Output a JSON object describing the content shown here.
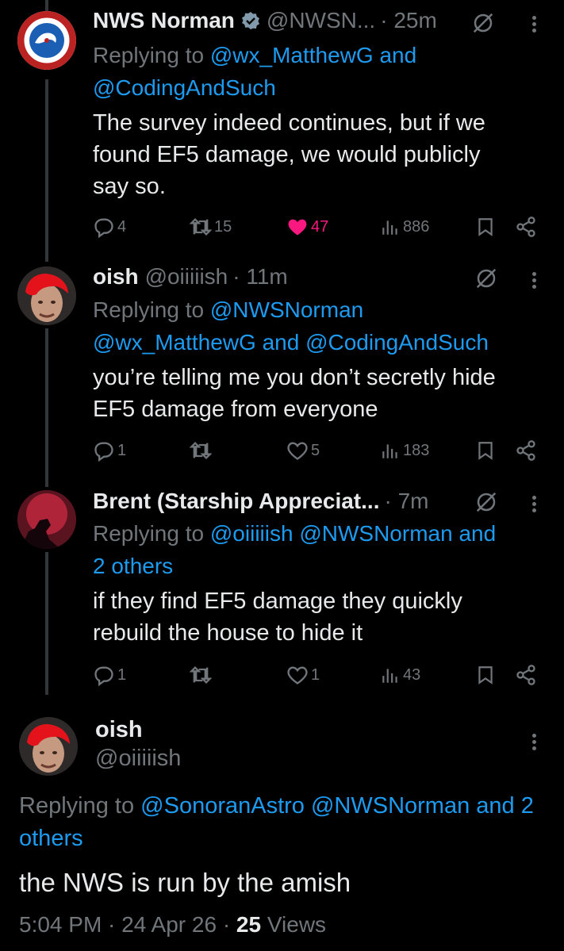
{
  "tweets": [
    {
      "name": "NWS Norman",
      "handle": "@NWSN...",
      "time": "· 25m",
      "replying_prefix": "Replying to",
      "replying_to_1": "@wx_MatthewG and",
      "replying_to_2": "@CodingAndSuch",
      "text_1": "The survey indeed continues, but if we",
      "text_2": "found EF5 damage, we would publicly",
      "text_3": "say so.",
      "replies": "4",
      "retweets": "15",
      "likes": "47",
      "views": "886"
    },
    {
      "name": "oish",
      "handle": "@oiiiiish",
      "time": "· 11m",
      "replying_prefix": "Replying to",
      "replying_to_1": "@NWSNorman",
      "replying_to_2": "@wx_MatthewG and @CodingAndSuch",
      "text_1": "you’re telling me you don’t secretly hide",
      "text_2": "EF5 damage from everyone",
      "replies": "1",
      "retweets": "",
      "likes": "5",
      "views": "183"
    },
    {
      "name": "Brent (Starship Appreciat...",
      "handle": "",
      "time": "· 7m",
      "replying_prefix": "Replying to",
      "replying_to_1": "@oiiiiish @NWSNorman and",
      "replying_to_2": "2 others",
      "text_1": "if they find EF5 damage they quickly",
      "text_2": "rebuild the house to hide it",
      "replies": "1",
      "retweets": "",
      "likes": "1",
      "views": "43"
    }
  ],
  "main": {
    "name": "oish",
    "handle": "@oiiiiish",
    "replying_prefix": "Replying to",
    "replying_to_1": "@SonoranAstro @NWSNorman and 2",
    "replying_to_2": "others",
    "text": "the NWS is run by the amish",
    "time": "5:04 PM · 24 Apr 26 ·",
    "views_count": "25",
    "views_label": "Views"
  },
  "colors": {
    "background": "#000000",
    "text": "#e7e9ea",
    "secondary": "#71767b",
    "link": "#1d9bf0",
    "like": "#f91880"
  },
  "icons": [
    "verified-badge-icon",
    "muted-icon",
    "more-icon",
    "reply-icon",
    "retweet-icon",
    "like-icon",
    "views-icon",
    "bookmark-icon",
    "share-icon"
  ]
}
